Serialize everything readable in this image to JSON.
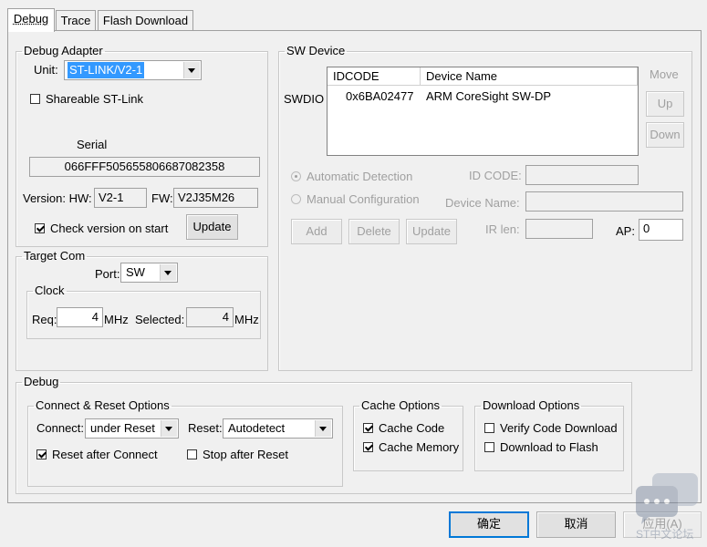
{
  "tabs": [
    {
      "label": "Debug",
      "active": true
    },
    {
      "label": "Trace"
    },
    {
      "label": "Flash Download"
    }
  ],
  "debug_adapter": {
    "legend": "Debug Adapter",
    "unit_label": "Unit:",
    "unit_value": "ST-LINK/V2-1",
    "shareable_label": "Shareable ST-Link",
    "serial_label": "Serial",
    "serial_value": "066FFF505655806687082358",
    "version_label": "Version: HW:",
    "hw_value": "V2-1",
    "fw_label": "FW:",
    "fw_value": "V2J35M26",
    "check_version_label": "Check version on start",
    "update_button": "Update"
  },
  "target_com": {
    "legend": "Target Com",
    "port_label": "Port:",
    "port_value": "SW",
    "clock_legend": "Clock",
    "req_label": "Req:",
    "req_value": "4",
    "req_unit": "MHz",
    "selected_label": "Selected:",
    "selected_value": "4",
    "selected_unit": "MHz"
  },
  "sw_device": {
    "legend": "SW Device",
    "move_label": "Move",
    "up_button": "Up",
    "down_button": "Down",
    "row_label": "SWDIO",
    "columns": [
      "IDCODE",
      "Device Name"
    ],
    "rows": [
      {
        "idcode": "0x6BA02477",
        "name": "ARM CoreSight SW-DP"
      }
    ],
    "auto_detect_label": "Automatic Detection",
    "manual_config_label": "Manual Configuration",
    "id_code_label": "ID CODE:",
    "device_name_label": "Device Name:",
    "ir_len_label": "IR len:",
    "ap_label": "AP:",
    "ap_value": "0",
    "add_button": "Add",
    "delete_button": "Delete",
    "update_button": "Update"
  },
  "debug": {
    "legend": "Debug",
    "connect_reset": {
      "legend": "Connect & Reset Options",
      "connect_label": "Connect:",
      "connect_value": "under Reset",
      "reset_label": "Reset:",
      "reset_value": "Autodetect",
      "reset_after_connect": "Reset after Connect",
      "stop_after_reset": "Stop after Reset"
    },
    "cache": {
      "legend": "Cache Options",
      "cache_code": "Cache Code",
      "cache_memory": "Cache Memory"
    },
    "download": {
      "legend": "Download Options",
      "verify": "Verify Code Download",
      "download_to_flash": "Download to Flash"
    }
  },
  "footer": {
    "ok_button": "确定",
    "cancel_button": "取消",
    "apply_button": "应用(A)",
    "watermark_text": "ST中文论坛"
  }
}
